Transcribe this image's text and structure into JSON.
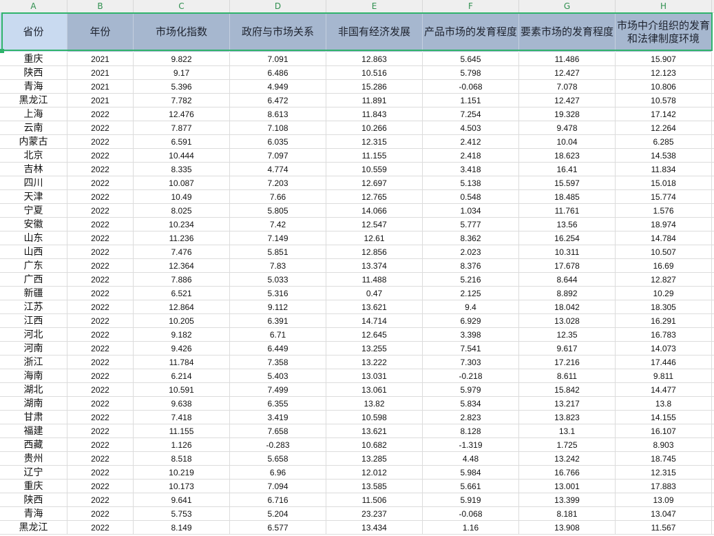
{
  "column_letters": [
    "A",
    "B",
    "C",
    "D",
    "E",
    "F",
    "G",
    "H"
  ],
  "headers": [
    "省份",
    "年份",
    "市场化指数",
    "政府与市场关系",
    "非国有经济发展",
    "产品市场的发育程度",
    "要素市场的发育程度",
    "市场中介组织的发育\n和法律制度环境"
  ],
  "rows": [
    [
      "重庆",
      "2021",
      "9.822",
      "7.091",
      "12.863",
      "5.645",
      "11.486",
      "15.907"
    ],
    [
      "陕西",
      "2021",
      "9.17",
      "6.486",
      "10.516",
      "5.798",
      "12.427",
      "12.123"
    ],
    [
      "青海",
      "2021",
      "5.396",
      "4.949",
      "15.286",
      "-0.068",
      "7.078",
      "10.806"
    ],
    [
      "黑龙江",
      "2021",
      "7.782",
      "6.472",
      "11.891",
      "1.151",
      "12.427",
      "10.578"
    ],
    [
      "上海",
      "2022",
      "12.476",
      "8.613",
      "11.843",
      "7.254",
      "19.328",
      "17.142"
    ],
    [
      "云南",
      "2022",
      "7.877",
      "7.108",
      "10.266",
      "4.503",
      "9.478",
      "12.264"
    ],
    [
      "内蒙古",
      "2022",
      "6.591",
      "6.035",
      "12.315",
      "2.412",
      "10.04",
      "6.285"
    ],
    [
      "北京",
      "2022",
      "10.444",
      "7.097",
      "11.155",
      "2.418",
      "18.623",
      "14.538"
    ],
    [
      "吉林",
      "2022",
      "8.335",
      "4.774",
      "10.559",
      "3.418",
      "16.41",
      "11.834"
    ],
    [
      "四川",
      "2022",
      "10.087",
      "7.203",
      "12.697",
      "5.138",
      "15.597",
      "15.018"
    ],
    [
      "天津",
      "2022",
      "10.49",
      "7.66",
      "12.765",
      "0.548",
      "18.485",
      "15.774"
    ],
    [
      "宁夏",
      "2022",
      "8.025",
      "5.805",
      "14.066",
      "1.034",
      "11.761",
      "1.576"
    ],
    [
      "安徽",
      "2022",
      "10.234",
      "7.42",
      "12.547",
      "5.777",
      "13.56",
      "18.974"
    ],
    [
      "山东",
      "2022",
      "11.236",
      "7.149",
      "12.61",
      "8.362",
      "16.254",
      "14.784"
    ],
    [
      "山西",
      "2022",
      "7.476",
      "5.851",
      "12.856",
      "2.023",
      "10.311",
      "10.507"
    ],
    [
      "广东",
      "2022",
      "12.364",
      "7.83",
      "13.374",
      "8.376",
      "17.678",
      "16.69"
    ],
    [
      "广西",
      "2022",
      "7.886",
      "5.033",
      "11.488",
      "5.216",
      "8.644",
      "12.827"
    ],
    [
      "新疆",
      "2022",
      "6.521",
      "5.316",
      "0.47",
      "2.125",
      "8.892",
      "10.29"
    ],
    [
      "江苏",
      "2022",
      "12.864",
      "9.112",
      "13.621",
      "9.4",
      "18.042",
      "18.305"
    ],
    [
      "江西",
      "2022",
      "10.205",
      "6.391",
      "14.714",
      "6.929",
      "13.028",
      "16.291"
    ],
    [
      "河北",
      "2022",
      "9.182",
      "6.71",
      "12.645",
      "3.398",
      "12.35",
      "16.783"
    ],
    [
      "河南",
      "2022",
      "9.426",
      "6.449",
      "13.255",
      "7.541",
      "9.617",
      "14.073"
    ],
    [
      "浙江",
      "2022",
      "11.784",
      "7.358",
      "13.222",
      "7.303",
      "17.216",
      "17.446"
    ],
    [
      "海南",
      "2022",
      "6.214",
      "5.403",
      "13.031",
      "-0.218",
      "8.611",
      "9.811"
    ],
    [
      "湖北",
      "2022",
      "10.591",
      "7.499",
      "13.061",
      "5.979",
      "15.842",
      "14.477"
    ],
    [
      "湖南",
      "2022",
      "9.638",
      "6.355",
      "13.82",
      "5.834",
      "13.217",
      "13.8"
    ],
    [
      "甘肃",
      "2022",
      "7.418",
      "3.419",
      "10.598",
      "2.823",
      "13.823",
      "14.155"
    ],
    [
      "福建",
      "2022",
      "11.155",
      "7.658",
      "13.621",
      "8.128",
      "13.1",
      "16.107"
    ],
    [
      "西藏",
      "2022",
      "1.126",
      "-0.283",
      "10.682",
      "-1.319",
      "1.725",
      "8.903"
    ],
    [
      "贵州",
      "2022",
      "8.518",
      "5.658",
      "13.285",
      "4.48",
      "13.242",
      "18.745"
    ],
    [
      "辽宁",
      "2022",
      "10.219",
      "6.96",
      "12.012",
      "5.984",
      "16.766",
      "12.315"
    ],
    [
      "重庆",
      "2022",
      "10.173",
      "7.094",
      "13.585",
      "5.661",
      "13.001",
      "17.883"
    ],
    [
      "陕西",
      "2022",
      "9.641",
      "6.716",
      "11.506",
      "5.919",
      "13.399",
      "13.09"
    ],
    [
      "青海",
      "2022",
      "5.753",
      "5.204",
      "23.237",
      "-0.068",
      "8.181",
      "13.047"
    ],
    [
      "黑龙江",
      "2022",
      "8.149",
      "6.577",
      "13.434",
      "1.16",
      "13.908",
      "11.567"
    ]
  ]
}
